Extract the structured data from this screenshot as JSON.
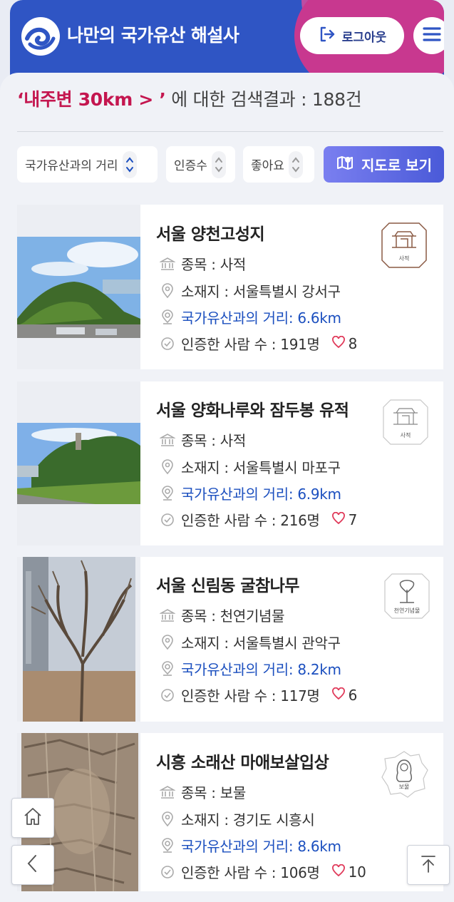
{
  "header": {
    "title": "나만의 국가유산 해설사",
    "logout_label": "로그아웃"
  },
  "search": {
    "keyword": "‘내주변 30km > ’",
    "suffix": " 에 대한 검색결과 : 188건"
  },
  "sort": {
    "distance": "국가유산과의 거리",
    "certified": "인증수",
    "likes": "좋아요",
    "map_button": "지도로 보기"
  },
  "colors": {
    "header_blue": "#2f55c4",
    "accent_pink": "#c8388f",
    "keyword_red": "#c4164f",
    "distance_blue": "#1b4fbf"
  },
  "results": [
    {
      "title": "서울 양천고성지",
      "category": "종목 : 사적",
      "location": "소재지 : 서울특별시 강서구",
      "distance": "국가유산과의 거리: 6.6km",
      "certified": "인증한 사람 수 : 191명",
      "likes": "8",
      "badge": "사적",
      "badge_icon": "gate-icon"
    },
    {
      "title": "서울 양화나루와 잠두봉 유적",
      "category": "종목 : 사적",
      "location": "소재지 : 서울특별시 마포구",
      "distance": "국가유산과의 거리: 6.9km",
      "certified": "인증한 사람 수 : 216명",
      "likes": "7",
      "badge": "사적",
      "badge_icon": "gate-icon"
    },
    {
      "title": "서울 신림동 굴참나무",
      "category": "종목 : 천연기념물",
      "location": "소재지 : 서울특별시 관악구",
      "distance": "국가유산과의 거리: 8.2km",
      "certified": "인증한 사람 수 : 117명",
      "likes": "6",
      "badge": "천연기념물",
      "badge_icon": "tree-icon"
    },
    {
      "title": "시흥 소래산 마애보살입상",
      "category": "종목 : 보물",
      "location": "소재지 : 경기도 시흥시",
      "distance": "국가유산과의 거리: 8.6km",
      "certified": "인증한 사람 수 : 106명",
      "likes": "10",
      "badge": "보물",
      "badge_icon": "buddha-icon"
    }
  ]
}
